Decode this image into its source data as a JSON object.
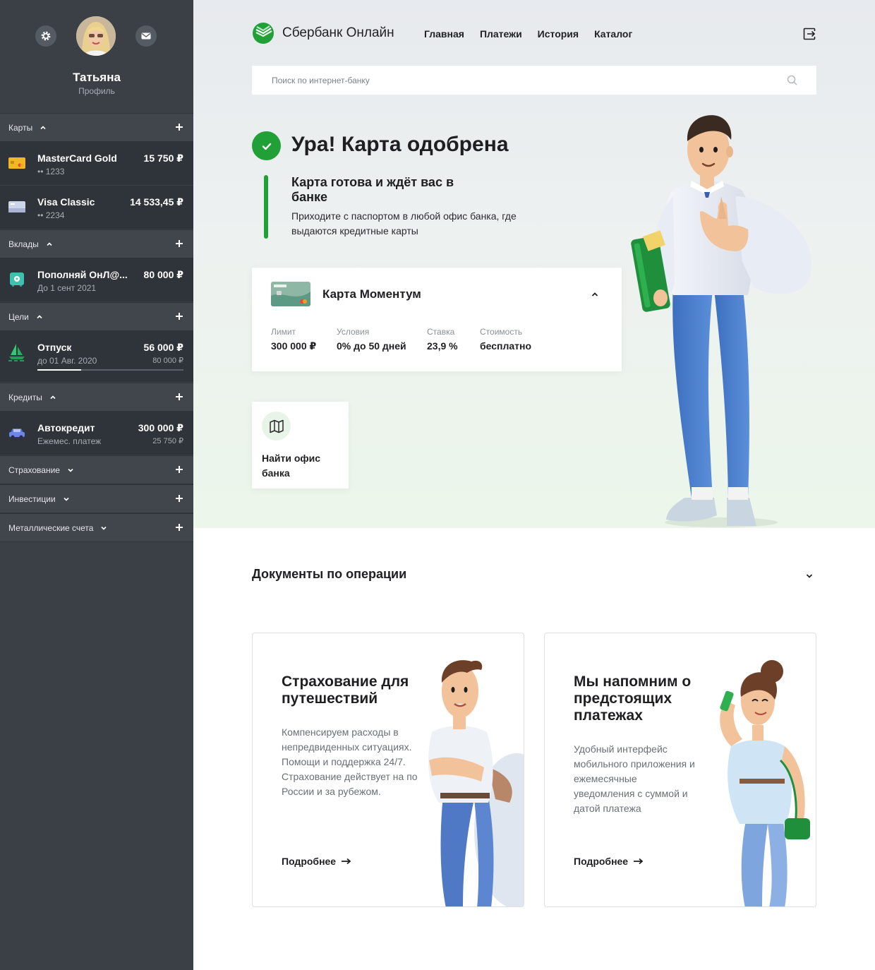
{
  "sidebar": {
    "profile": {
      "name": "Татьяна",
      "subtitle": "Профиль"
    },
    "sections": {
      "cards": {
        "label": "Карты"
      },
      "deposits": {
        "label": "Вклады"
      },
      "goals": {
        "label": "Цели"
      },
      "credits": {
        "label": "Кредиты"
      },
      "insurance": {
        "label": "Страхование"
      },
      "investments": {
        "label": "Инвестиции"
      },
      "metal": {
        "label": "Металлические счета"
      }
    },
    "cards": [
      {
        "name": "MasterCard Gold",
        "number": "•• 1233",
        "balance": "15 750 ₽"
      },
      {
        "name": "Visa Classic",
        "number": "•• 2234",
        "balance": "14 533,45 ₽"
      }
    ],
    "deposit": {
      "name": "Пополняй ОнЛ@...",
      "sub": "До 1 сент 2021",
      "amount": "80 000 ₽"
    },
    "goal": {
      "name": "Отпуск",
      "sub": "до 01 Авг. 2020",
      "amount": "56 000 ₽",
      "target": "80 000 ₽",
      "progress": 0.3
    },
    "credit": {
      "name": "Автокредит",
      "sub": "Ежемес. платеж",
      "amount": "300 000 ₽",
      "payment": "25 750 ₽"
    }
  },
  "header": {
    "brand": "Сбербанк Онлайн",
    "nav": [
      "Главная",
      "Платежи",
      "История",
      "Каталог"
    ]
  },
  "search": {
    "placeholder": "Поиск по интернет-банку"
  },
  "hero": {
    "title": "Ура! Карта одобрена",
    "ready_title": "Карта готова и ждёт вас в банке",
    "ready_text": "Приходите с паспортом в любой офис банка, где выдаются кредитные карты"
  },
  "card": {
    "name": "Карта Моментум",
    "params": [
      {
        "label": "Лимит",
        "value": "300 000 ₽"
      },
      {
        "label": "Условия",
        "value": "0% до 50 дней"
      },
      {
        "label": "Ставка",
        "value": "23,9 %"
      },
      {
        "label": "Стоимость",
        "value": "бесплатно"
      }
    ]
  },
  "find_office": {
    "label": "Найти офис банка"
  },
  "documents": {
    "title": "Документы по операции"
  },
  "promos": [
    {
      "title": "Страхование для путешествий",
      "text": "Компенсируем расходы в непредвиденных ситуациях. Помощи и поддержка 24/7. Страхование действует на по России и за рубежом.",
      "more": "Подробнее"
    },
    {
      "title": "Мы напомним о предстоящих платежах",
      "text": "Удобный интерфейс мобильного приложения и ежемесячные уведомления с суммой и датой платежа",
      "more": "Подробнее"
    }
  ],
  "colors": {
    "brand_green": "#21a038",
    "sidebar_bg": "#3b4047",
    "sidebar_item_bg": "#2f343a"
  }
}
